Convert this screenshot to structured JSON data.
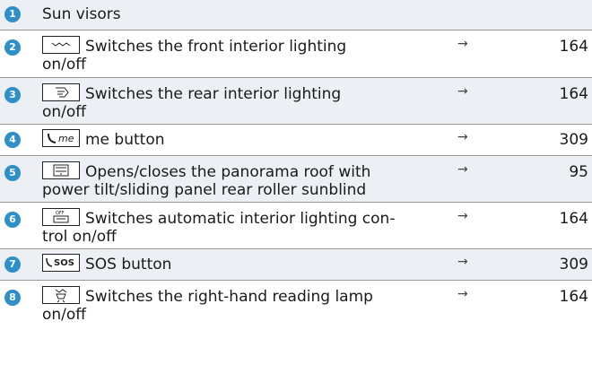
{
  "rows": [
    {
      "num": "1",
      "text": "Sun visors",
      "arrow": "",
      "page": ""
    },
    {
      "num": "2",
      "line1": "Switches the front interior lighting",
      "line2": "on/off",
      "arrow": "→",
      "page": "164",
      "icon": "front-interior-light-icon"
    },
    {
      "num": "3",
      "line1": "Switches the rear interior lighting",
      "line2": "on/off",
      "arrow": "→",
      "page": "164",
      "icon": "rear-interior-light-icon"
    },
    {
      "num": "4",
      "text": "me button",
      "arrow": "→",
      "page": "309",
      "icon": "me-phone-icon"
    },
    {
      "num": "5",
      "line1": "Opens/closes the panorama roof with",
      "line2": "power tilt/sliding panel rear roller sunblind",
      "arrow": "→",
      "page": "95",
      "icon": "panorama-roof-icon"
    },
    {
      "num": "6",
      "line1": "Switches automatic interior lighting con-",
      "line2": "trol on/off",
      "arrow": "→",
      "page": "164",
      "icon": "auto-interior-light-icon",
      "icon_label": "OFF"
    },
    {
      "num": "7",
      "text": "SOS button",
      "arrow": "→",
      "page": "309",
      "icon": "sos-icon",
      "icon_label": "SOS"
    },
    {
      "num": "8",
      "line1": "Switches the right-hand reading lamp",
      "line2": "on/off",
      "arrow": "→",
      "page": "164",
      "icon": "reading-lamp-icon"
    }
  ]
}
